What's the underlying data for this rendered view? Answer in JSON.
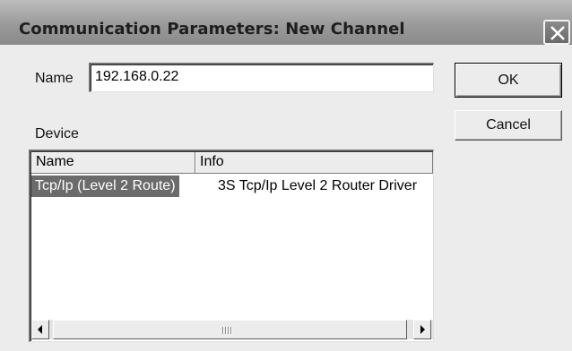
{
  "dialog": {
    "title": "Communication Parameters: New Channel"
  },
  "name_field": {
    "label": "Name",
    "value": "192.168.0.22"
  },
  "buttons": {
    "ok_label": "OK",
    "cancel_label": "Cancel"
  },
  "device": {
    "label": "Device",
    "columns": [
      "Name",
      "Info"
    ],
    "rows": [
      {
        "name": "Tcp/Ip (Level 2 Route)",
        "info": "3S Tcp/Ip Level 2 Router Driver",
        "selected": true
      }
    ]
  },
  "icons": {
    "close": "close-icon",
    "scroll_left": "arrow-left-icon",
    "scroll_right": "arrow-right-icon",
    "thumb_grip": "grip-icon"
  },
  "colors": {
    "selection_bg": "#6b6b6b",
    "selection_text": "#ffffff",
    "window_bg": "#ececec"
  }
}
